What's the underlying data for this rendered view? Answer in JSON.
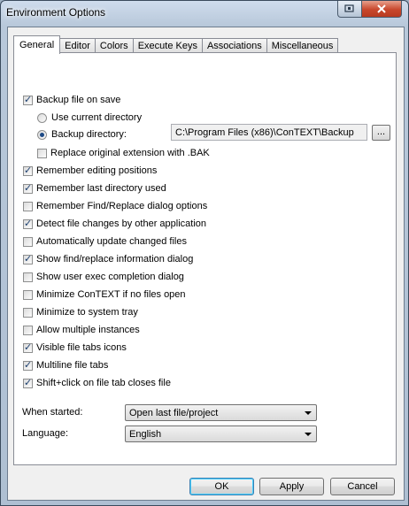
{
  "window": {
    "title": "Environment Options"
  },
  "tabs": [
    "General",
    "Editor",
    "Colors",
    "Execute Keys",
    "Associations",
    "Miscellaneous"
  ],
  "backup": {
    "label": "Backup file on save",
    "use_current": "Use current directory",
    "backup_dir_label": "Backup directory:",
    "backup_dir_value": "C:\\Program Files (x86)\\ConTEXT\\Backup",
    "browse_label": "...",
    "replace_ext": "Replace original extension with .BAK"
  },
  "options": [
    {
      "label": "Remember editing positions",
      "checked": true
    },
    {
      "label": "Remember last directory used",
      "checked": true
    },
    {
      "label": "Remember Find/Replace dialog options",
      "checked": false
    },
    {
      "label": "Detect file changes by other application",
      "checked": true
    },
    {
      "label": "Automatically update changed files",
      "checked": false
    },
    {
      "label": "Show find/replace information dialog",
      "checked": true
    },
    {
      "label": "Show user exec completion dialog",
      "checked": false
    },
    {
      "label": "Minimize ConTEXT if no files open",
      "checked": false
    },
    {
      "label": "Minimize to system tray",
      "checked": false
    },
    {
      "label": "Allow multiple instances",
      "checked": false
    },
    {
      "label": "Visible file tabs icons",
      "checked": true
    },
    {
      "label": "Multiline file tabs",
      "checked": true
    },
    {
      "label": "Shift+click on file tab closes file",
      "checked": true
    }
  ],
  "when_started": {
    "label": "When started:",
    "value": "Open last file/project"
  },
  "language": {
    "label": "Language:",
    "value": "English"
  },
  "buttons": {
    "ok": "OK",
    "apply": "Apply",
    "cancel": "Cancel"
  },
  "icons": {
    "help": "help-icon",
    "close": "close-icon",
    "dropdown": "chevron-down-icon"
  }
}
